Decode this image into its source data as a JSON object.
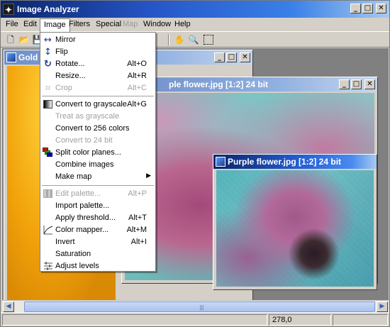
{
  "app": {
    "title": "Image Analyzer"
  },
  "window_buttons": {
    "minimize": "_",
    "maximize": "□",
    "close": "✕"
  },
  "menubar": {
    "file": "File",
    "edit": "Edit",
    "image": "Image",
    "filters": "Filters",
    "special": "Special",
    "map": "Map",
    "window": "Window",
    "help": "Help"
  },
  "toolbar": {
    "icons": [
      "new-icon",
      "open-icon",
      "save-icon",
      "hand-icon",
      "zoom-icon",
      "select-icon"
    ]
  },
  "windows": {
    "gold": {
      "title": "Gold P"
    },
    "purple1": {
      "title": "ple flower.jpg [1:2] 24 bit"
    },
    "purple2": {
      "title": "Purple flower.jpg [1:2] 24 bit"
    }
  },
  "image_menu": {
    "items": [
      {
        "label": "Mirror",
        "shortcut": "",
        "icon": "mirror-icon"
      },
      {
        "label": "Flip",
        "shortcut": "",
        "icon": "flip-icon"
      },
      {
        "label": "Rotate...",
        "shortcut": "Alt+O",
        "icon": "rotate-icon"
      },
      {
        "label": "Resize...",
        "shortcut": "Alt+R"
      },
      {
        "label": "Crop",
        "shortcut": "Alt+C",
        "icon": "crop-icon",
        "disabled": true
      },
      {
        "label": "Convert to grayscale",
        "shortcut": "Alt+G",
        "icon": "grayscale-icon"
      },
      {
        "label": "Treat as grayscale",
        "shortcut": "",
        "disabled": true
      },
      {
        "label": "Convert to 256 colors",
        "shortcut": ""
      },
      {
        "label": "Convert to 24 bit",
        "shortcut": "",
        "disabled": true
      },
      {
        "label": "Split color planes...",
        "shortcut": "",
        "icon": "color-planes-icon"
      },
      {
        "label": "Combine images",
        "shortcut": ""
      },
      {
        "label": "Make map",
        "shortcut": "",
        "submenu": "▶"
      },
      {
        "label": "Edit palette...",
        "shortcut": "Alt+P",
        "icon": "palette-icon",
        "disabled": true
      },
      {
        "label": "Import palette...",
        "shortcut": ""
      },
      {
        "label": "Apply threshold...",
        "shortcut": "Alt+T"
      },
      {
        "label": "Color mapper...",
        "shortcut": "Alt+M",
        "icon": "curve-icon"
      },
      {
        "label": "Invert",
        "shortcut": "Alt+I"
      },
      {
        "label": "Saturation",
        "shortcut": ""
      },
      {
        "label": "Adjust levels",
        "shortcut": "",
        "icon": "levels-icon"
      }
    ]
  },
  "statusbar": {
    "coords": "278,0"
  }
}
